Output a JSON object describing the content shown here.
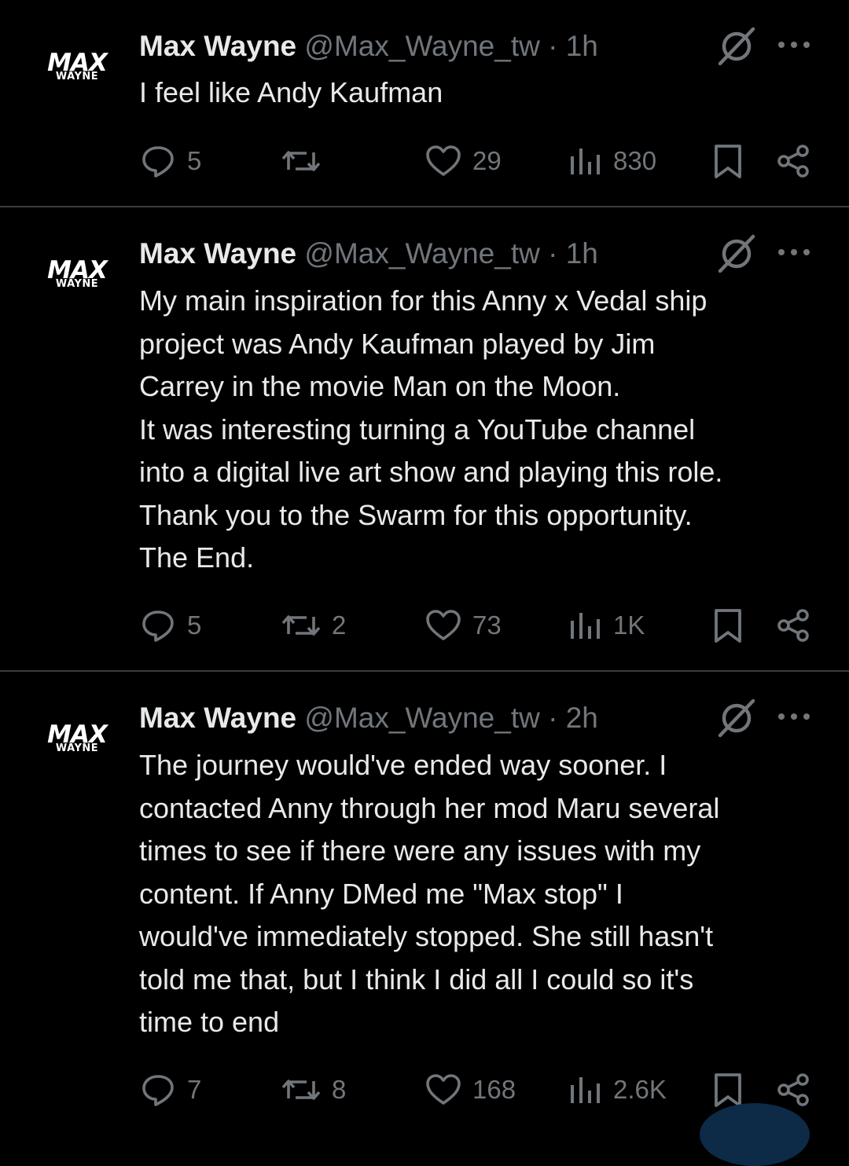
{
  "tweets": [
    {
      "name": "Max Wayne",
      "handle": "@Max_Wayne_tw",
      "time": "1h",
      "text": [
        "I feel like Andy Kaufman"
      ],
      "replies": "5",
      "reposts": "",
      "likes": "29",
      "views": "830"
    },
    {
      "name": "Max Wayne",
      "handle": "@Max_Wayne_tw",
      "time": "1h",
      "text": [
        "My main inspiration for this Anny x Vedal ship",
        "project was Andy Kaufman played by Jim",
        "Carrey in the movie Man on the Moon.",
        "It was interesting turning a YouTube channel",
        "into a digital live art show and playing this role.",
        "Thank you to the Swarm for this opportunity.",
        "The End."
      ],
      "replies": "5",
      "reposts": "2",
      "likes": "73",
      "views": "1K"
    },
    {
      "name": "Max Wayne",
      "handle": "@Max_Wayne_tw",
      "time": "2h",
      "text": [
        "The journey would've ended way sooner. I",
        "contacted Anny through her mod Maru several",
        "times to see if there were any issues with my",
        "content. If Anny DMed me \"Max stop\" I",
        "would've immediately stopped. She still hasn't",
        "told me that, but I think I did all I could so it's",
        "time to end"
      ],
      "replies": "7",
      "reposts": "8",
      "likes": "168",
      "views": "2.6K"
    }
  ],
  "avatar": {
    "line1": "MAX",
    "line2": "WAYNE"
  },
  "icons": {
    "reply": "reply-icon",
    "repost": "repost-icon",
    "like": "heart-icon",
    "views": "views-icon",
    "bookmark": "bookmark-icon",
    "share": "share-icon",
    "grok": "grok-icon",
    "more": "more-icon"
  },
  "colors": {
    "background": "#000000",
    "text": "#e7e9ea",
    "muted": "#71767b",
    "divider": "#3a3d41"
  }
}
